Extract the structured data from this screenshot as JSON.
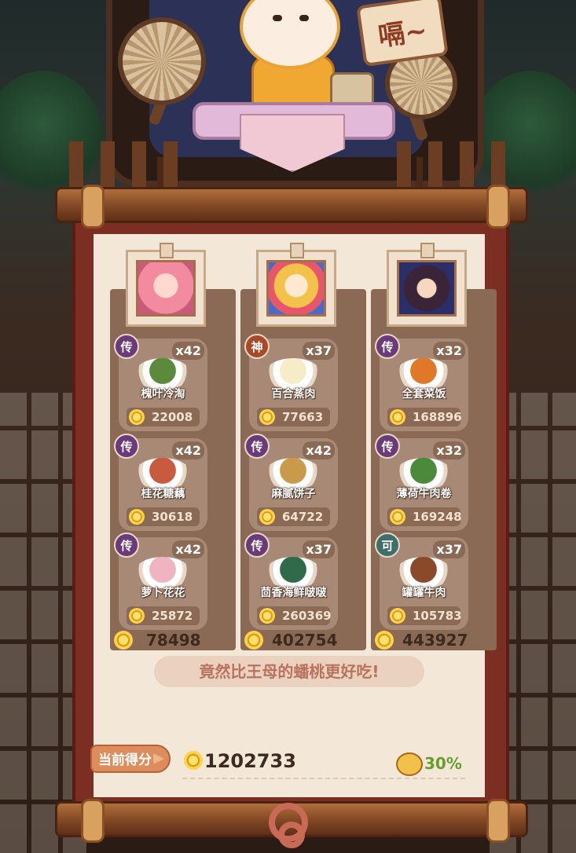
{
  "sign_text": "嗝~",
  "badge_colors": {
    "传": "#6b3a7a",
    "神": "#a84a2a",
    "可": "#3f6f6a"
  },
  "columns": [
    {
      "portrait": "pink-haired-girl",
      "total": "78498",
      "dishes": [
        {
          "badge": "传",
          "count": "x42",
          "name": "槐叶冷淘",
          "score": "22008",
          "food": "#5a8a3a"
        },
        {
          "badge": "传",
          "count": "x42",
          "name": "桂花糖藕",
          "score": "30618",
          "food": "#c85a40"
        },
        {
          "badge": "传",
          "count": "x42",
          "name": "萝卜花花",
          "score": "25872",
          "food": "#f0b4c0"
        }
      ]
    },
    {
      "portrait": "sun-headdress-girl",
      "total": "402754",
      "dishes": [
        {
          "badge": "神",
          "count": "x37",
          "name": "百合蒸肉",
          "score": "77663",
          "food": "#f6ecc8"
        },
        {
          "badge": "传",
          "count": "x42",
          "name": "麻腻饼子",
          "score": "64722",
          "food": "#c89a4a"
        },
        {
          "badge": "传",
          "count": "x37",
          "name": "茴香海鲜啵啵",
          "score": "260369",
          "food": "#2f6a4a"
        }
      ]
    },
    {
      "portrait": "dark-haired-boy",
      "total": "443927",
      "dishes": [
        {
          "badge": "传",
          "count": "x32",
          "name": "全套菜饭",
          "score": "168896",
          "food": "#e0782a"
        },
        {
          "badge": "传",
          "count": "x32",
          "name": "薄荷牛肉卷",
          "score": "169248",
          "food": "#4a8a3a"
        },
        {
          "badge": "可",
          "count": "x37",
          "name": "罐罐牛肉",
          "score": "105783",
          "food": "#8a4a2a"
        }
      ]
    }
  ],
  "quote": "竟然比王母的蟠桃更好吃!",
  "score_label": "当前得分",
  "current_score": "1202733",
  "percent": "30%"
}
